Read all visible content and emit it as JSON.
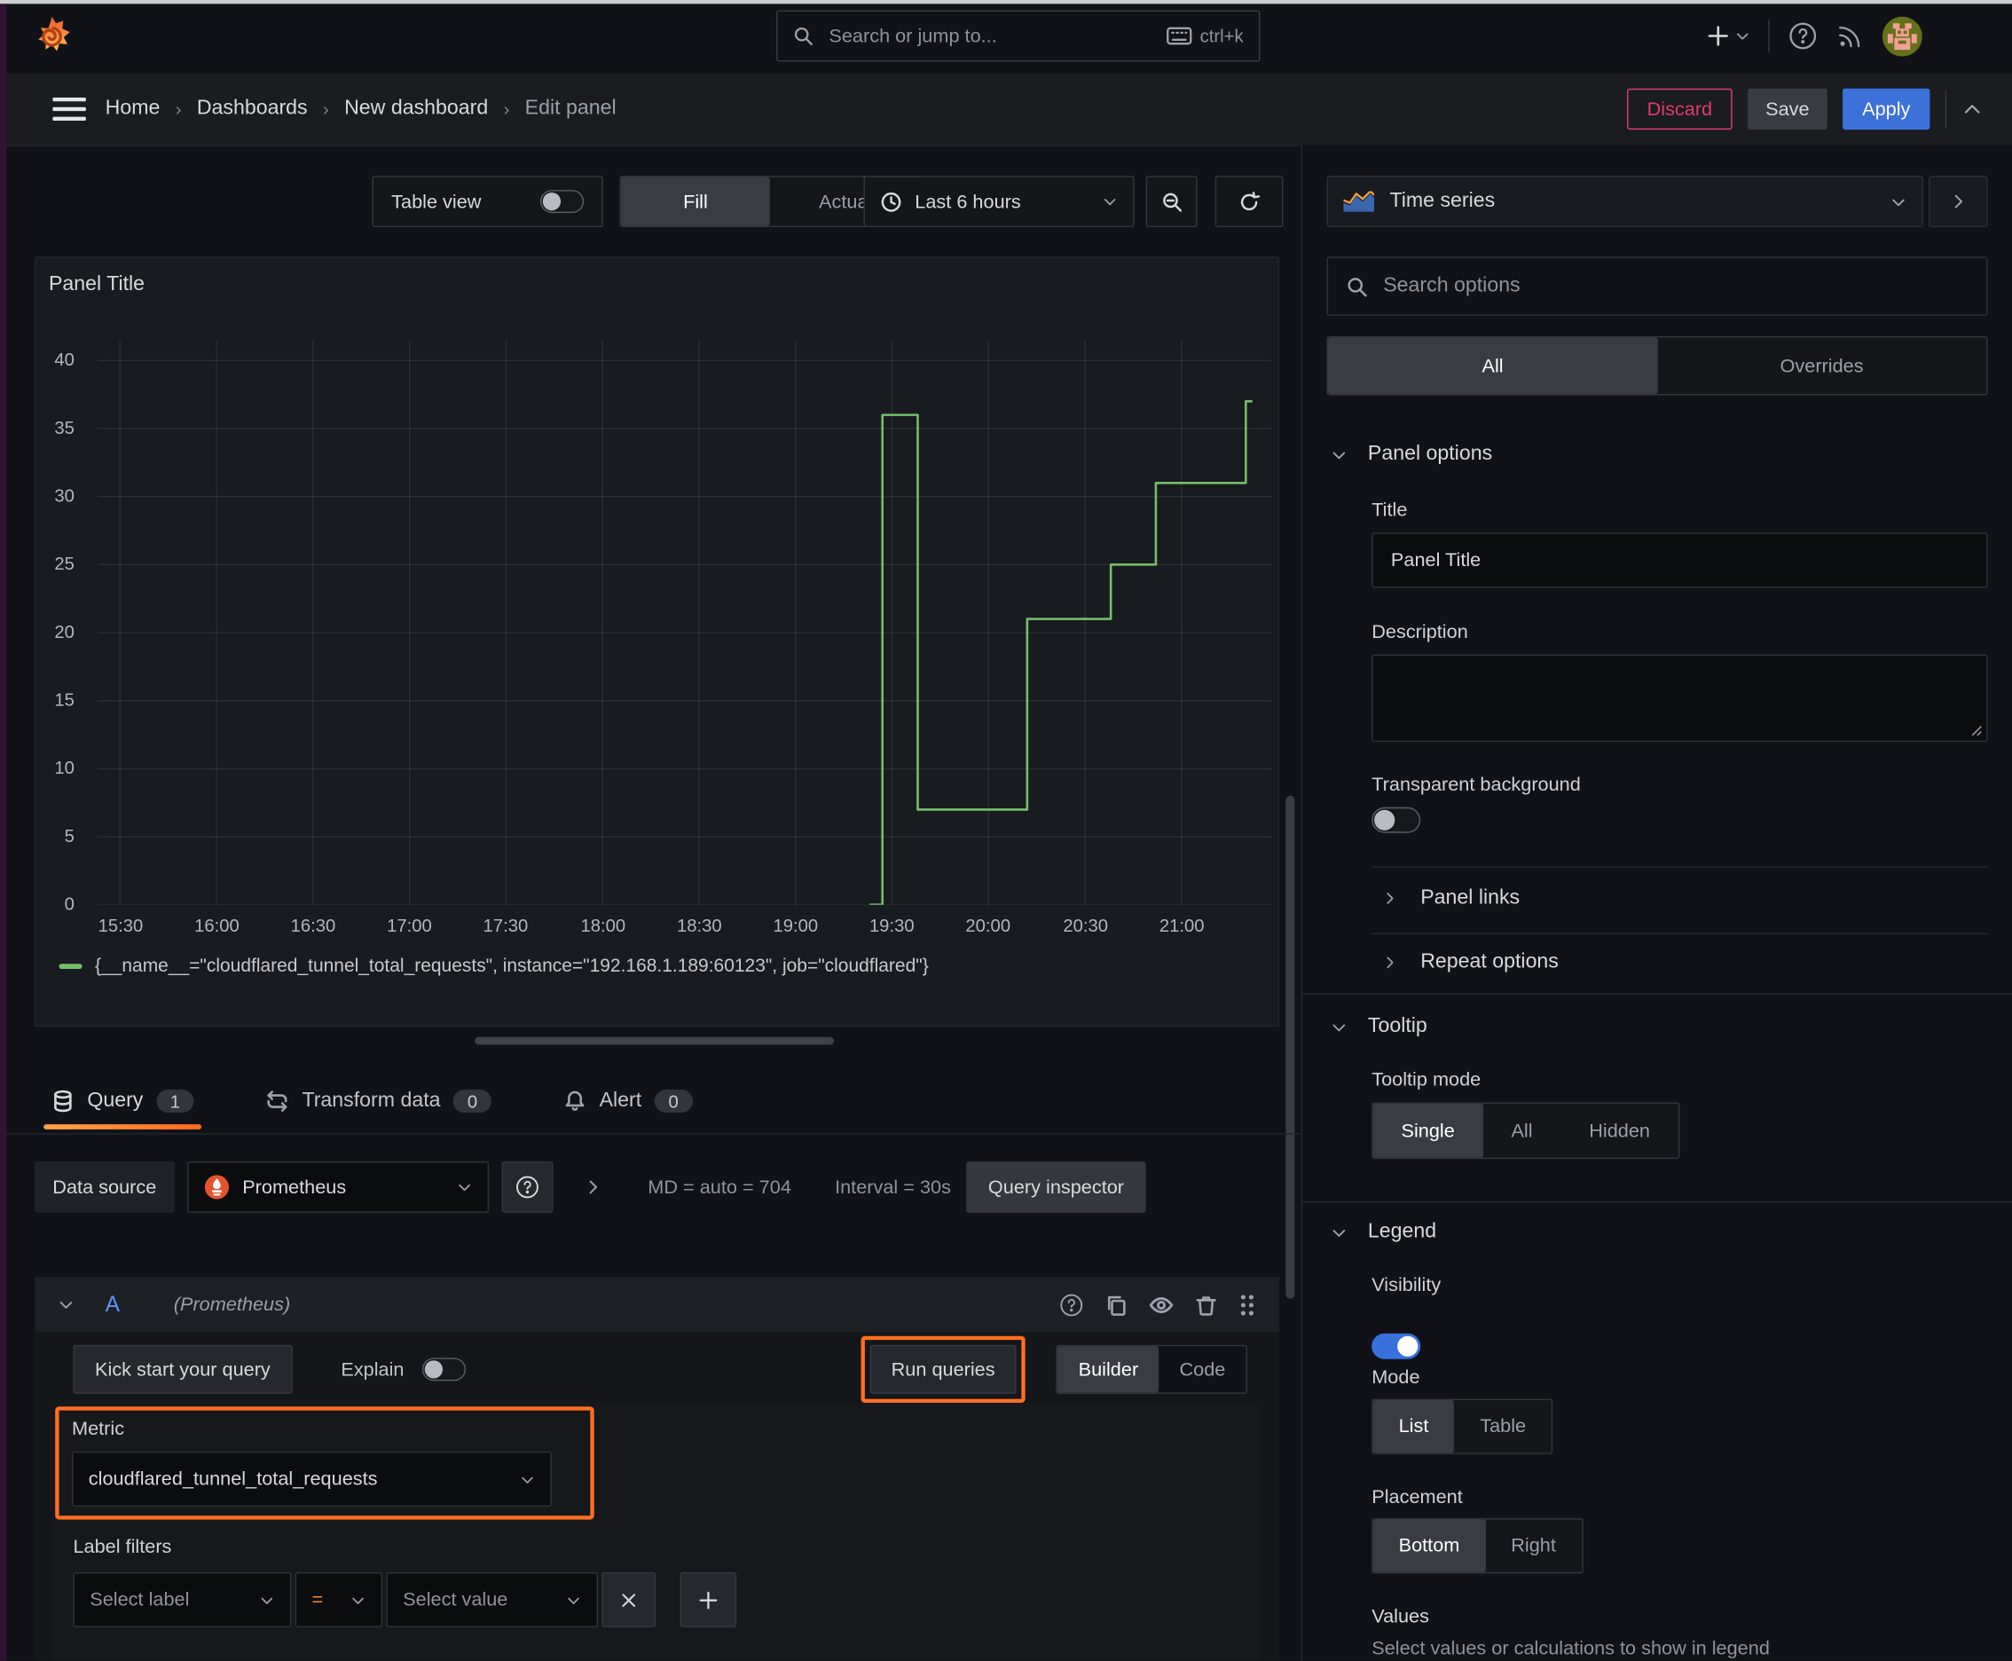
{
  "topbar": {
    "search_placeholder": "Search or jump to...",
    "search_shortcut": "ctrl+k"
  },
  "breadcrumb": {
    "items": [
      "Home",
      "Dashboards",
      "New dashboard",
      "Edit panel"
    ]
  },
  "header_actions": {
    "discard": "Discard",
    "save": "Save",
    "apply": "Apply"
  },
  "view_toolbar": {
    "table_view": "Table view",
    "fill": "Fill",
    "actual": "Actual",
    "time_range": "Last 6 hours"
  },
  "panel": {
    "title": "Panel Title"
  },
  "chart_data": {
    "type": "line",
    "title": "Panel Title",
    "xlabel": "",
    "ylabel": "",
    "grid": true,
    "legend_position": "bottom",
    "y_ticks": [
      0,
      5,
      10,
      15,
      20,
      25,
      30,
      35,
      40
    ],
    "y_domain": [
      0,
      41.5
    ],
    "x_ticks": [
      "15:30",
      "16:00",
      "16:30",
      "17:00",
      "17:30",
      "18:00",
      "18:30",
      "19:00",
      "19:30",
      "20:00",
      "20:30",
      "21:00"
    ],
    "x_tick_minutes": [
      930,
      960,
      990,
      1020,
      1050,
      1080,
      1110,
      1140,
      1170,
      1200,
      1230,
      1260
    ],
    "x_domain_minutes": [
      923,
      1288
    ],
    "series": [
      {
        "name": "{__name__=\"cloudflared_tunnel_total_requests\", instance=\"192.168.1.189:60123\", job=\"cloudflared\"}",
        "color": "#73bf69",
        "points_minute_value": [
          [
            1163,
            0
          ],
          [
            1167,
            0
          ],
          [
            1167,
            36
          ],
          [
            1178,
            36
          ],
          [
            1178,
            7
          ],
          [
            1212,
            7
          ],
          [
            1212,
            21
          ],
          [
            1238,
            21
          ],
          [
            1238,
            25
          ],
          [
            1252,
            25
          ],
          [
            1252,
            31
          ],
          [
            1280,
            31
          ],
          [
            1280,
            37
          ],
          [
            1282,
            37
          ]
        ]
      }
    ]
  },
  "query_tabs": {
    "query": "Query",
    "query_count": "1",
    "transform": "Transform data",
    "transform_count": "0",
    "alert": "Alert",
    "alert_count": "0"
  },
  "datasource_row": {
    "label": "Data source",
    "name": "Prometheus",
    "stats_md": "MD = auto = 704",
    "stats_interval": "Interval = 30s",
    "inspector": "Query inspector"
  },
  "query_editor": {
    "ref_id": "A",
    "ds_hint": "(Prometheus)",
    "kickstart": "Kick start your query",
    "explain": "Explain",
    "run": "Run queries",
    "builder": "Builder",
    "code": "Code",
    "metric_label": "Metric",
    "metric_value": "cloudflared_tunnel_total_requests",
    "label_filters": "Label filters",
    "select_label": "Select label",
    "operator": "=",
    "select_value": "Select value"
  },
  "options_pane": {
    "viz_name": "Time series",
    "search_placeholder": "Search options",
    "filter_all": "All",
    "filter_overrides": "Overrides",
    "panel_options": {
      "header": "Panel options",
      "title_label": "Title",
      "title_value": "Panel Title",
      "description_label": "Description",
      "transparent_label": "Transparent background"
    },
    "panel_links": "Panel links",
    "repeat_options": "Repeat options",
    "tooltip": {
      "header": "Tooltip",
      "mode_label": "Tooltip mode",
      "single": "Single",
      "all": "All",
      "hidden": "Hidden"
    },
    "legend": {
      "header": "Legend",
      "visibility": "Visibility",
      "mode_label": "Mode",
      "list": "List",
      "table": "Table",
      "placement_label": "Placement",
      "bottom": "Bottom",
      "right": "Right",
      "values_label": "Values",
      "values_hint": "Select values or calculations to show in legend"
    }
  },
  "colors": {
    "highlight_orange": "#ff6f1f",
    "series_green": "#73bf69",
    "accent_blue": "#3c71d9",
    "discard_pink": "#e23a70"
  }
}
